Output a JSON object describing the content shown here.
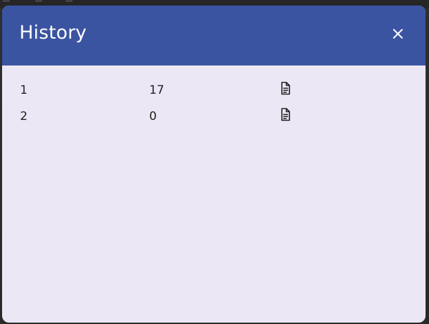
{
  "background": {
    "app_area": "dark-gray"
  },
  "modal": {
    "title": "History",
    "close_icon": "close-icon",
    "header_color": "#3b54a1",
    "body_color": "#ebe7f4",
    "text_color": "#1f1f1f"
  },
  "history": {
    "rows": [
      {
        "index": "1",
        "value": "17",
        "icon": "document-icon"
      },
      {
        "index": "2",
        "value": "0",
        "icon": "document-icon"
      }
    ]
  }
}
